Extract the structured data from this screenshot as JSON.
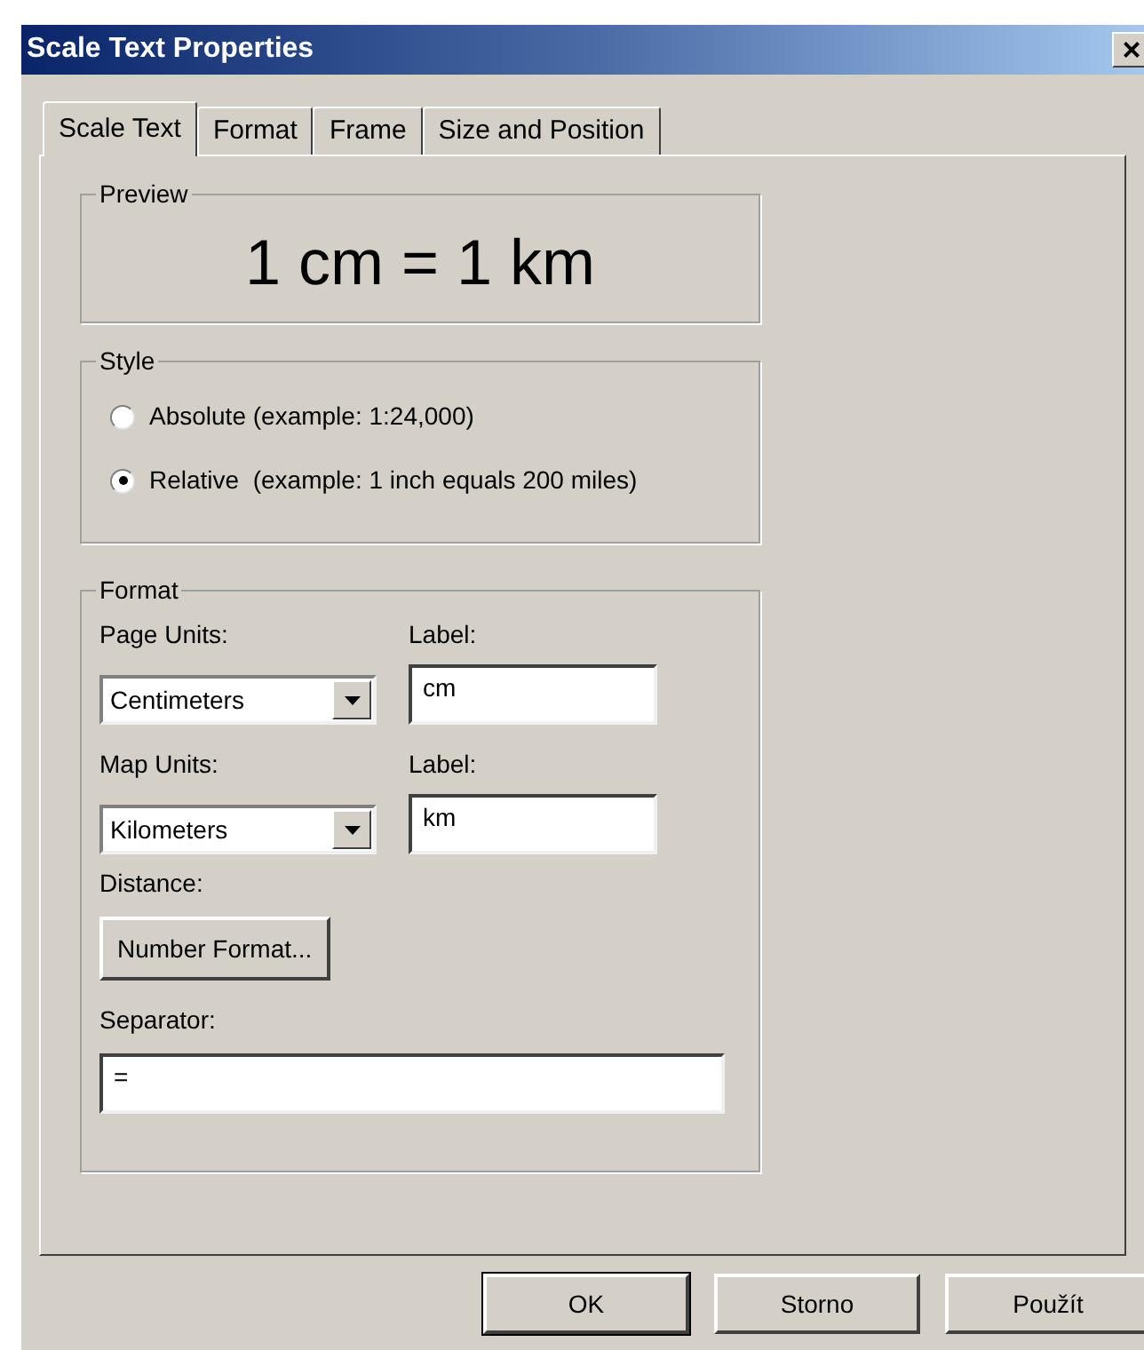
{
  "window": {
    "title": "Scale Text Properties",
    "close": "×"
  },
  "tabs": [
    {
      "label": "Scale Text",
      "selected": true
    },
    {
      "label": "Format",
      "selected": false
    },
    {
      "label": "Frame",
      "selected": false
    },
    {
      "label": "Size and Position",
      "selected": false
    }
  ],
  "preview": {
    "legend": "Preview",
    "text": "1 cm = 1 km"
  },
  "style": {
    "legend": "Style",
    "options": [
      {
        "label": "Absolute (example: 1:24,000)",
        "selected": false
      },
      {
        "label": "Relative  (example: 1 inch equals 200 miles)",
        "selected": true
      }
    ]
  },
  "format": {
    "legend": "Format",
    "page_units": {
      "label": "Page Units:",
      "value": "Centimeters"
    },
    "page_label": {
      "label": "Label:",
      "value": "cm"
    },
    "map_units": {
      "label": "Map Units:",
      "value": "Kilometers"
    },
    "map_label": {
      "label": "Label:",
      "value": "km"
    },
    "distance": {
      "label": "Distance:",
      "button": "Number Format..."
    },
    "separator": {
      "label": "Separator:",
      "value": "="
    }
  },
  "buttons": [
    {
      "label": "OK",
      "default": true
    },
    {
      "label": "Storno",
      "default": false
    },
    {
      "label": "Použít",
      "default": false
    }
  ]
}
